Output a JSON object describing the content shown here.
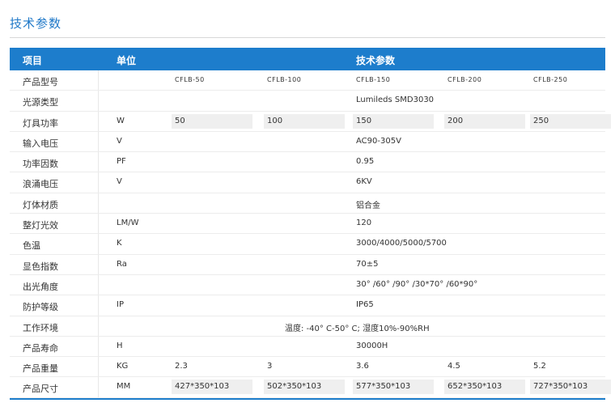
{
  "title": "技术参数",
  "header": {
    "item": "项目",
    "unit": "单位",
    "params": "技术参数"
  },
  "rows": [
    {
      "name": "产品型号",
      "unit": "",
      "models": [
        "CFLB-50",
        "CFLB-100",
        "CFLB-150",
        "CFLB-200",
        "CFLB-250"
      ]
    },
    {
      "name": "光源类型",
      "unit": "",
      "value": "Lumileds SMD3030"
    },
    {
      "name": "灯具功率",
      "unit": "W",
      "cells": [
        "50",
        "100",
        "150",
        "200",
        "250"
      ]
    },
    {
      "name": "输入电压",
      "unit": "V",
      "value": "AC90-305V"
    },
    {
      "name": "功率因数",
      "unit": "PF",
      "value": "0.95"
    },
    {
      "name": "浪涌电压",
      "unit": "V",
      "value": "6KV"
    },
    {
      "name": "灯体材质",
      "unit": "",
      "value": "铝合金"
    },
    {
      "name": "整灯光效",
      "unit": "LM/W",
      "value": "120"
    },
    {
      "name": "色温",
      "unit": "K",
      "value": "3000/4000/5000/5700"
    },
    {
      "name": "显色指数",
      "unit": "Ra",
      "value": "70±5"
    },
    {
      "name": "出光角度",
      "unit": "",
      "value": "30° /60° /90° /30*70° /60*90°"
    },
    {
      "name": "防护等级",
      "unit": "IP",
      "value": "IP65"
    },
    {
      "name": "工作环境",
      "unit": "",
      "value": "温度: -40° C-50° C; 湿度10%-90%RH"
    },
    {
      "name": "产品寿命",
      "unit": "H",
      "value": "30000H"
    },
    {
      "name": "产品重量",
      "unit": "KG",
      "plain": [
        "2.3",
        "3",
        "3.6",
        "4.5",
        "5.2"
      ]
    },
    {
      "name": "产品尺寸",
      "unit": "MM",
      "cells": [
        "427*350*103",
        "502*350*103",
        "577*350*103",
        "652*350*103",
        "727*350*103"
      ]
    }
  ]
}
